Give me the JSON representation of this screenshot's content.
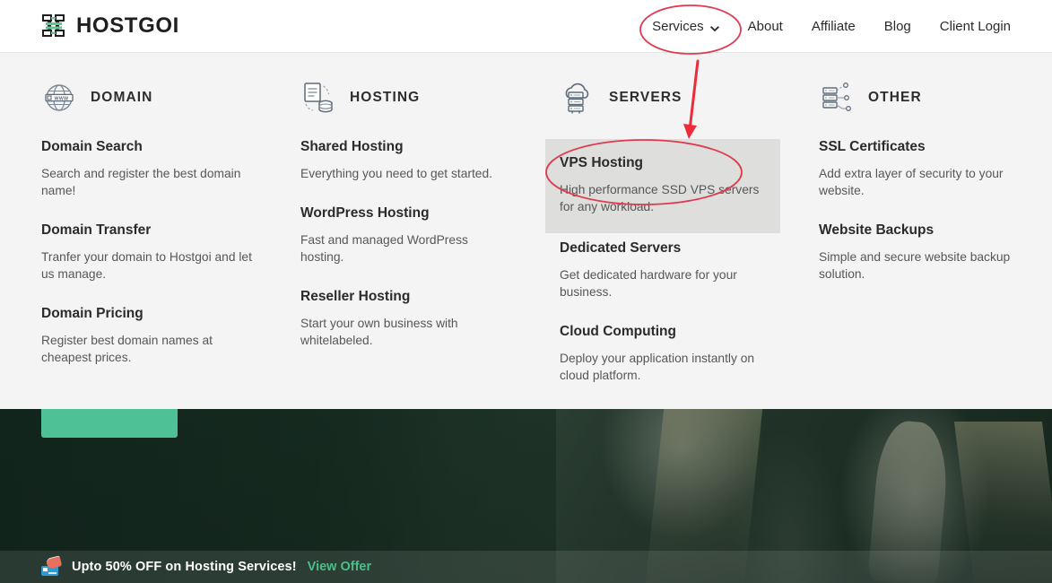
{
  "brand": {
    "name": "HOSTGOI",
    "logo_icon": "server-rack-logo-icon",
    "accent_color": "#4ec296"
  },
  "nav": {
    "items": [
      {
        "label": "Services",
        "icon": "chevron-down-icon",
        "has_caret": true,
        "active": true
      },
      {
        "label": "About",
        "has_caret": false
      },
      {
        "label": "Affiliate",
        "has_caret": false
      },
      {
        "label": "Blog",
        "has_caret": false
      },
      {
        "label": "Client Login",
        "has_caret": false
      }
    ]
  },
  "mega_menu": {
    "columns": [
      {
        "title": "DOMAIN",
        "icon": "globe-www-icon",
        "entries": [
          {
            "title": "Domain Search",
            "desc": "Search and register the best domain name!"
          },
          {
            "title": "Domain Transfer",
            "desc": "Tranfer your domain to Hostgoi and let us manage."
          },
          {
            "title": "Domain Pricing",
            "desc": "Register best domain names at cheapest prices."
          }
        ]
      },
      {
        "title": "HOSTING",
        "icon": "document-database-icon",
        "entries": [
          {
            "title": "Shared Hosting",
            "desc": "Everything you need to get started."
          },
          {
            "title": "WordPress Hosting",
            "desc": "Fast and managed WordPress hosting."
          },
          {
            "title": "Reseller Hosting",
            "desc": "Start your own business with whitelabeled."
          }
        ]
      },
      {
        "title": "SERVERS",
        "icon": "cloud-server-icon",
        "entries": [
          {
            "title": "VPS Hosting",
            "desc": "High performance SSD VPS servers for any workload.",
            "highlighted": true
          },
          {
            "title": "Dedicated Servers",
            "desc": "Get dedicated hardware for your business."
          },
          {
            "title": "Cloud Computing",
            "desc": "Deploy your application instantly on cloud platform."
          }
        ]
      },
      {
        "title": "OTHER",
        "icon": "server-network-icon",
        "entries": [
          {
            "title": "SSL Certificates",
            "desc": "Add extra layer of security to your website."
          },
          {
            "title": "Website Backups",
            "desc": "Simple and secure website backup solution."
          }
        ]
      }
    ]
  },
  "hero": {
    "cta_label": "",
    "background": "dark-green-photo"
  },
  "promo_bar": {
    "icon": "megaphone-card-emoji",
    "text": "Upto 50% OFF on Hosting Services!",
    "link_label": "View Offer",
    "link_color": "#4bbf8a"
  },
  "annotations": {
    "color": "#e03a4e",
    "shapes": [
      {
        "type": "ellipse",
        "target": "Services"
      },
      {
        "type": "arrow",
        "from": "Services",
        "to": "VPS Hosting"
      },
      {
        "type": "ellipse",
        "target": "VPS Hosting"
      }
    ]
  }
}
